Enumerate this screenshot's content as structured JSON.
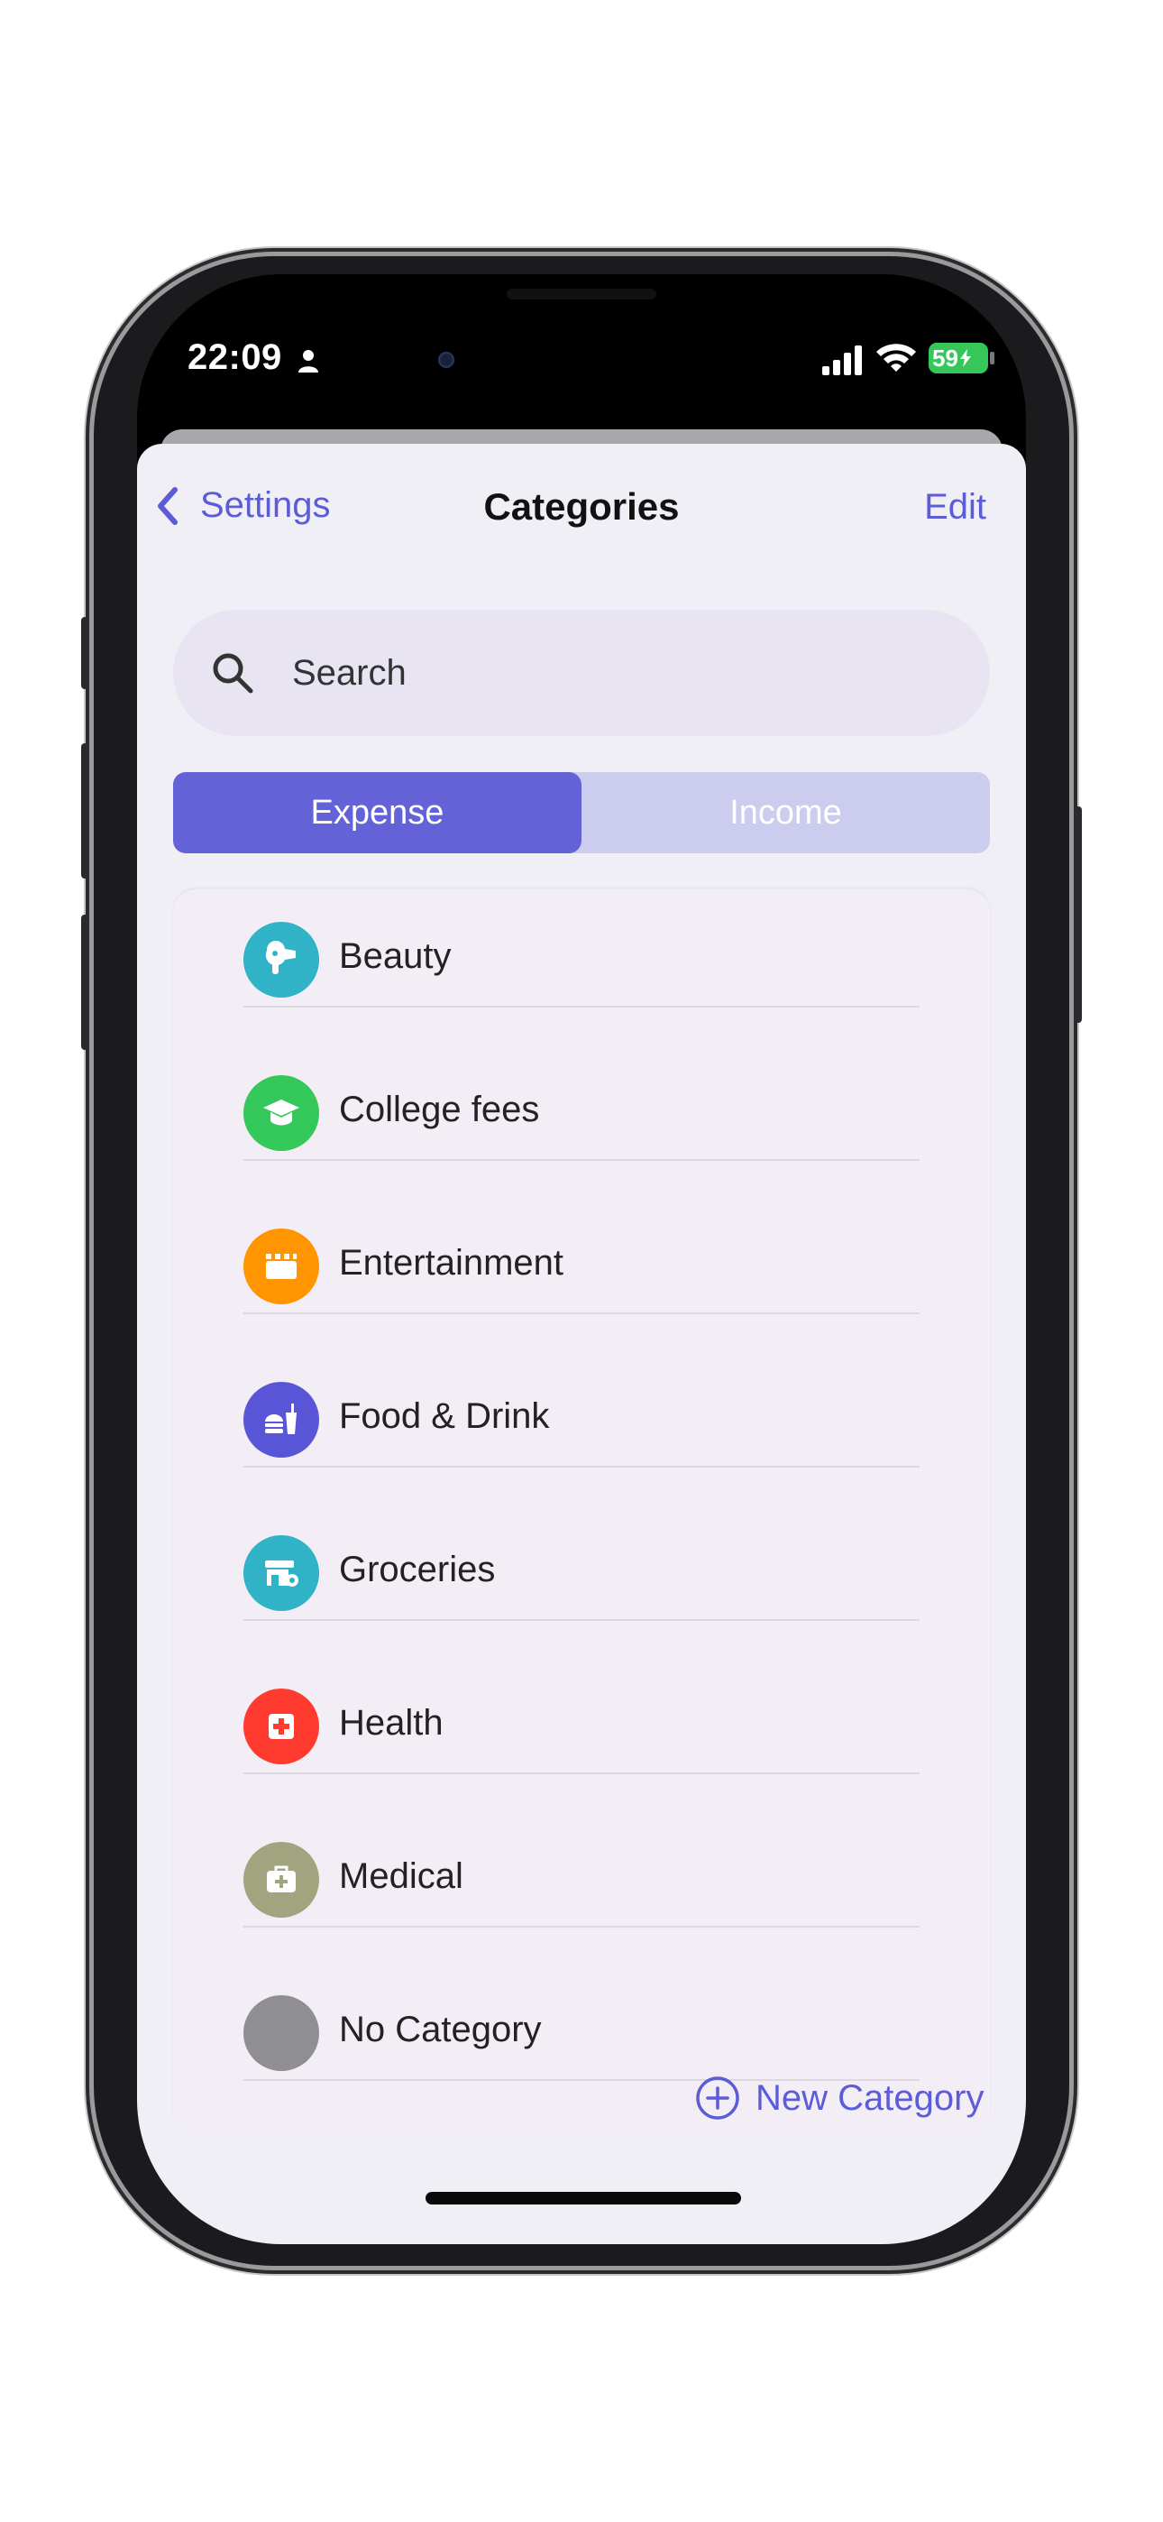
{
  "status_bar": {
    "time": "22:09",
    "battery": "59"
  },
  "nav": {
    "back_label": "Settings",
    "title": "Categories",
    "edit_label": "Edit"
  },
  "search": {
    "placeholder": "Search"
  },
  "segment": {
    "expense": "Expense",
    "income": "Income",
    "selected": "Expense"
  },
  "categories": [
    {
      "label": "Beauty",
      "color": "#30b3c7",
      "icon": "hair-dryer-icon"
    },
    {
      "label": "College fees",
      "color": "#34c759",
      "icon": "graduation-cap-icon"
    },
    {
      "label": "Entertainment",
      "color": "#ff9500",
      "icon": "clapperboard-icon"
    },
    {
      "label": "Food & Drink",
      "color": "#5856d6",
      "icon": "burger-drink-icon"
    },
    {
      "label": "Groceries",
      "color": "#30b3c7",
      "icon": "store-icon"
    },
    {
      "label": "Health",
      "color": "#ff3b30",
      "icon": "first-aid-icon"
    },
    {
      "label": "Medical",
      "color": "#a2a37f",
      "icon": "medical-bag-icon"
    },
    {
      "label": "No Category",
      "color": "#8e8e93",
      "icon": "none"
    }
  ],
  "new_category": {
    "label": "New Category"
  },
  "colors": {
    "accent": "#5c5cd6",
    "segment_active": "#6362d6",
    "segment_inactive": "#cccdee"
  }
}
